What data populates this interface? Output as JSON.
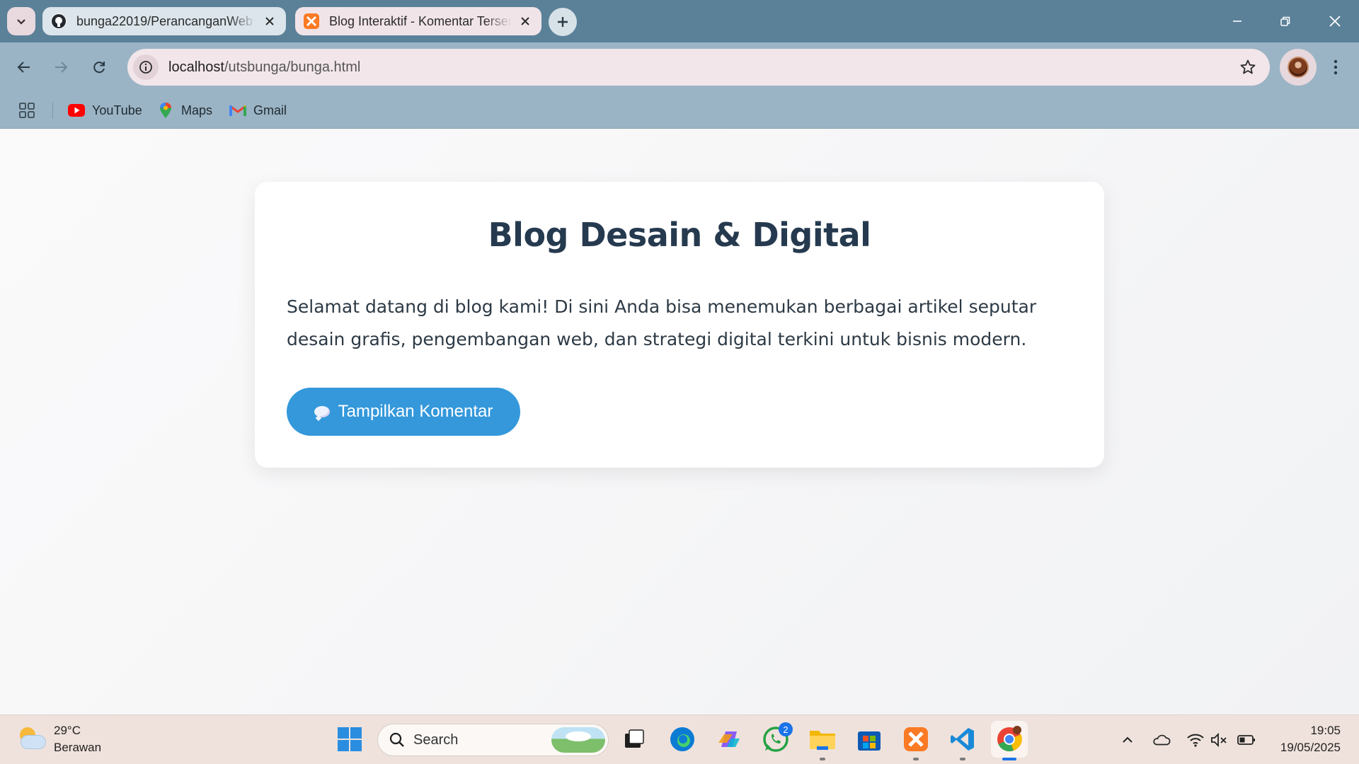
{
  "browser": {
    "tabs": [
      {
        "title": "bunga22019/PerancanganWeb",
        "active": false,
        "icon": "github-icon"
      },
      {
        "title": "Blog Interaktif - Komentar Tersembunyi",
        "active": true,
        "icon": "xampp-icon"
      }
    ],
    "address_bar": {
      "host": "localhost",
      "path": "/utsbunga/bunga.html"
    },
    "bookmarks": [
      {
        "label": "YouTube",
        "icon": "youtube-icon"
      },
      {
        "label": "Maps",
        "icon": "maps-icon"
      },
      {
        "label": "Gmail",
        "icon": "gmail-icon"
      }
    ]
  },
  "page": {
    "title": "Blog Desain & Digital",
    "intro": "Selamat datang di blog kami! Di sini Anda bisa menemukan berbagai artikel seputar desain grafis, pengembangan web, dan strategi digital terkini untuk bisnis modern.",
    "button_label": "Tampilkan Komentar"
  },
  "taskbar": {
    "weather": {
      "temperature": "29°C",
      "condition": "Berawan"
    },
    "search_placeholder": "Search",
    "whatsapp_badge": "2",
    "clock": {
      "time": "19:05",
      "date": "19/05/2025"
    }
  },
  "colors": {
    "tabstrip": "#5b8199",
    "toolbar": "#9bb4c5",
    "heading": "#263a4f",
    "button": "#3498db",
    "taskbar": "#efe2dc"
  }
}
